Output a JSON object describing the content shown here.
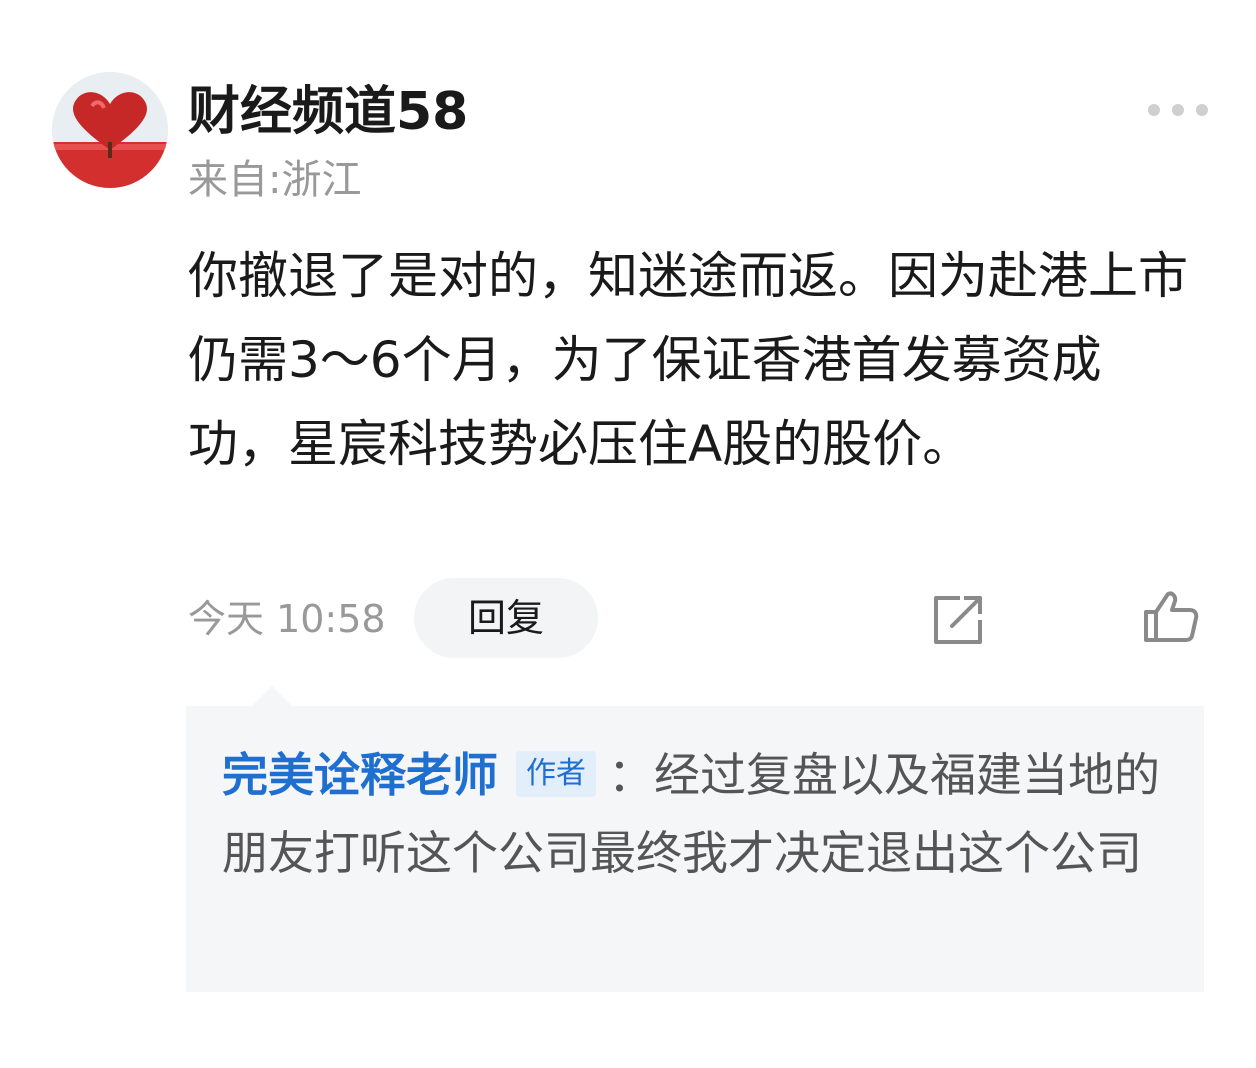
{
  "comment": {
    "username": "财经频道58",
    "location": "来自:浙江",
    "text": "你撤退了是对的，知迷途而返。因为赴港上市仍需3～6个月，为了保证香港首发募资成功，星宸科技势必压住A股的股价。",
    "time": "今天 10:58",
    "reply_label": "回复"
  },
  "reply": {
    "author": "完美诠释老师",
    "badge": "作者",
    "separator": "：",
    "text": "经过复盘以及福建当地的朋友打听这个公司最终我才决定退出这个公司"
  },
  "icons": {
    "more": "more-dots-icon",
    "share": "share-icon",
    "like": "thumbs-up-icon"
  },
  "colors": {
    "link_blue": "#1f6fd1",
    "secondary_gray": "#999999",
    "reply_bg": "#f5f6f8"
  }
}
